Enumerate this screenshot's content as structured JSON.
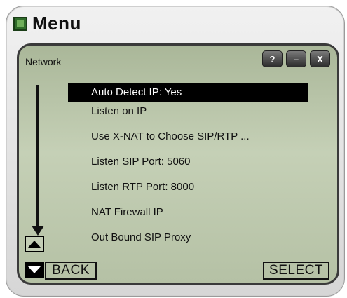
{
  "window": {
    "title": "Menu"
  },
  "panel": {
    "section": "Network"
  },
  "window_buttons": {
    "help": "?",
    "minimize": "–",
    "close": "X"
  },
  "menu": {
    "items": [
      {
        "label": "Auto Detect IP: Yes",
        "selected": true
      },
      {
        "label": "Listen on IP"
      },
      {
        "label": "Use X-NAT to Choose SIP/RTP ..."
      },
      {
        "label": "Listen SIP Port: 5060"
      },
      {
        "label": "Listen RTP Port: 8000"
      },
      {
        "label": "NAT Firewall IP"
      },
      {
        "label": "Out Bound SIP Proxy"
      }
    ]
  },
  "softkeys": {
    "back": "BACK",
    "select": "SELECT"
  },
  "icons": {
    "app": "app-icon",
    "scroll_up": "scroll-up-icon",
    "scroll_down": "scroll-down-icon",
    "scroll_arrow": "scroll-indicator-arrow"
  }
}
